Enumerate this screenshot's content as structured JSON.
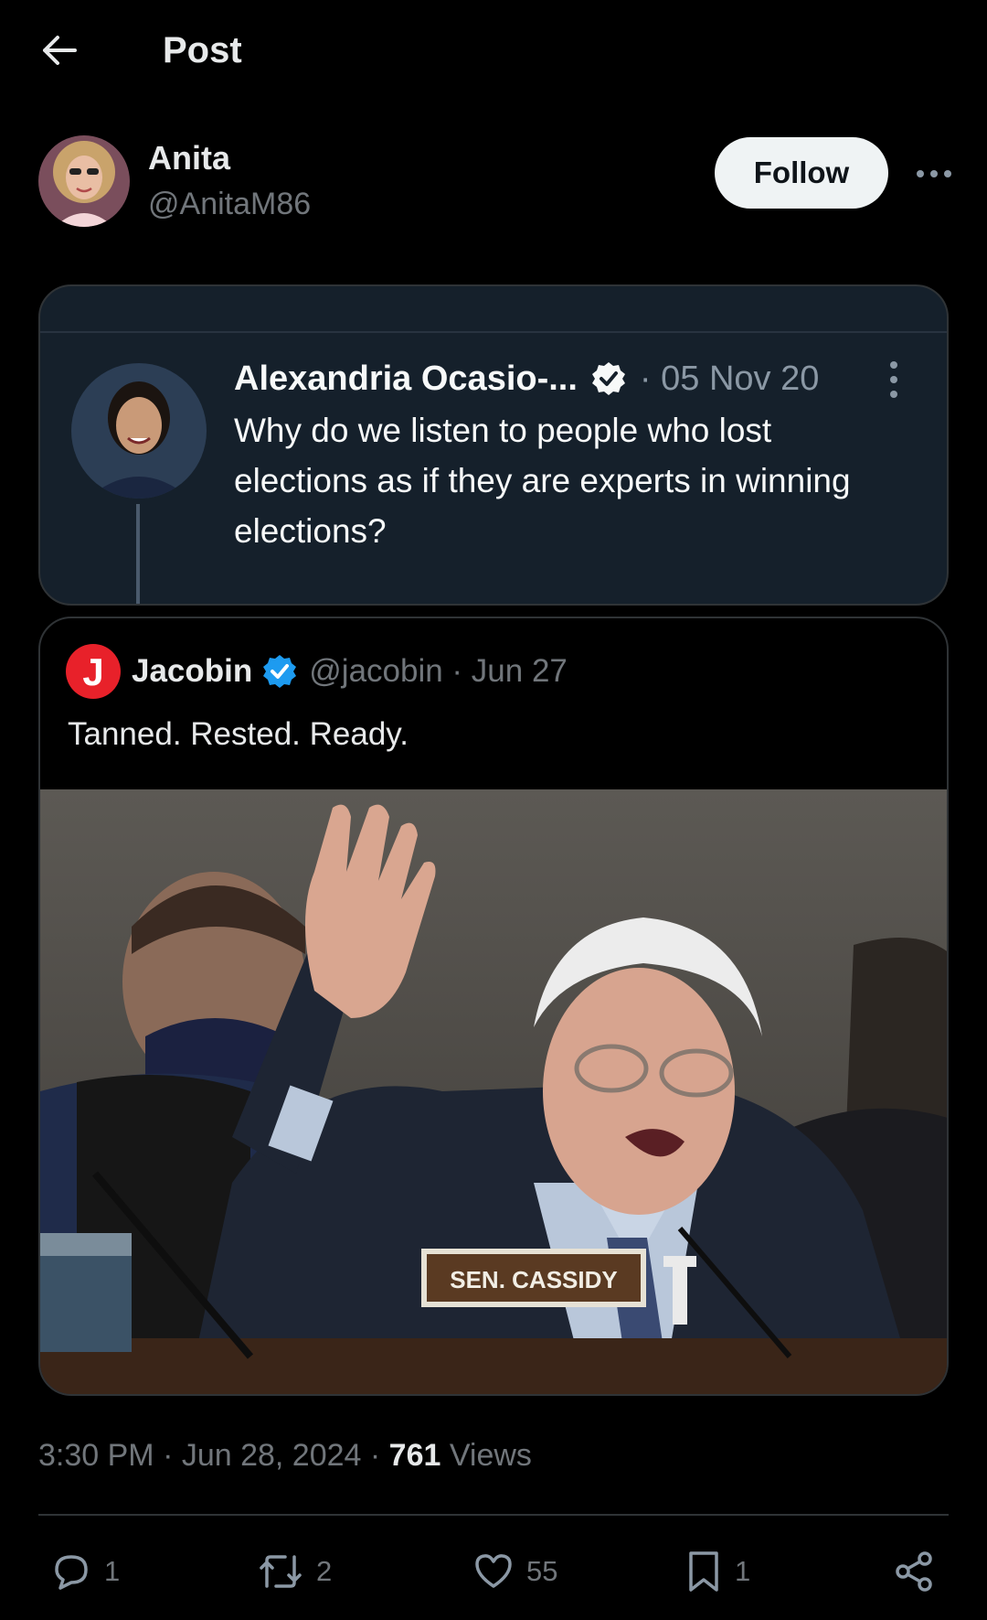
{
  "header": {
    "title": "Post"
  },
  "author": {
    "name": "Anita",
    "handle": "@AnitaM86",
    "follow_label": "Follow"
  },
  "embedded_post": {
    "name": "Alexandria Ocasio-...",
    "date": "· 05 Nov 20",
    "text": "Why do we listen to people who lost elections as if they are experts in winning elections?"
  },
  "quoted_post": {
    "name": "Jacobin",
    "handle": "@jacobin · Jun 27",
    "text": "Tanned. Rested. Ready.",
    "logo_letter": "J",
    "image_nameplate": "SEN. CASSIDY"
  },
  "meta": {
    "timestamp": "3:30 PM · Jun 28, 2024 · ",
    "views_count": "761",
    "views_label": " Views"
  },
  "actions": {
    "replies": "1",
    "reposts": "2",
    "likes": "55",
    "bookmarks": "1"
  },
  "colors": {
    "accent_blue": "#1d9bf0",
    "jacobin_red": "#e8212a",
    "card_bg": "#15202b"
  }
}
